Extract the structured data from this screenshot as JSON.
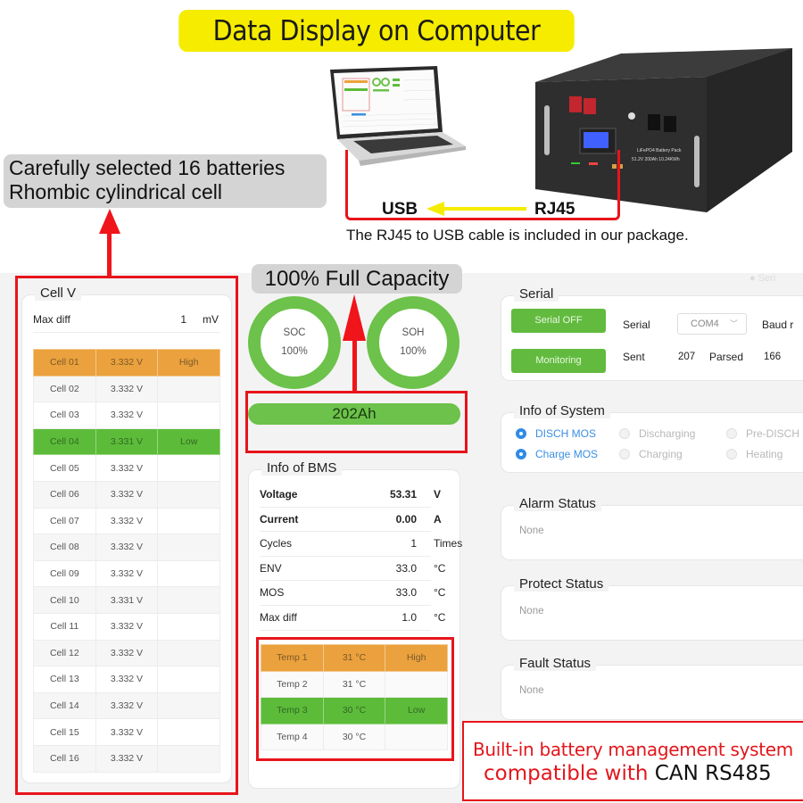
{
  "banner": {
    "title": "Data Display on Computer"
  },
  "connection": {
    "usb_label": "USB",
    "rj45_label": "RJ45",
    "note": "The RJ45 to USB cable is included in our package.",
    "battery_label_line1": "LiFePO4 Battery Pack",
    "battery_label_line2": "51.2V 200Ah 10.24KWh"
  },
  "callouts": {
    "batteries_line1": "Carefully selected 16 batteries",
    "batteries_line2": "Rhombic cylindrical cell",
    "capacity": "100% Full Capacity",
    "bms_line1": "Built-in battery management system",
    "bms_line2_red": "compatible with ",
    "bms_line2_dark": "CAN RS485"
  },
  "colors": {
    "high": "#eba13d",
    "low": "#5dbb3a",
    "accent_green": "#6cc24a",
    "accent_blue": "#2f8ce6",
    "highlight_red": "#e8141b",
    "banner_yellow": "#f5ec00"
  },
  "cell_voltage": {
    "title": "Cell V",
    "max_diff_label": "Max diff",
    "max_diff_value": "1",
    "max_diff_unit": "mV",
    "cells": [
      {
        "name": "Cell 01",
        "voltage": "3.332 V",
        "flag": "High"
      },
      {
        "name": "Cell 02",
        "voltage": "3.332 V",
        "flag": ""
      },
      {
        "name": "Cell 03",
        "voltage": "3.332 V",
        "flag": ""
      },
      {
        "name": "Cell 04",
        "voltage": "3.331 V",
        "flag": "Low"
      },
      {
        "name": "Cell 05",
        "voltage": "3.332 V",
        "flag": ""
      },
      {
        "name": "Cell 06",
        "voltage": "3.332 V",
        "flag": ""
      },
      {
        "name": "Cell 07",
        "voltage": "3.332 V",
        "flag": ""
      },
      {
        "name": "Cell 08",
        "voltage": "3.332 V",
        "flag": ""
      },
      {
        "name": "Cell 09",
        "voltage": "3.332 V",
        "flag": ""
      },
      {
        "name": "Cell 10",
        "voltage": "3.331 V",
        "flag": ""
      },
      {
        "name": "Cell 11",
        "voltage": "3.332 V",
        "flag": ""
      },
      {
        "name": "Cell 12",
        "voltage": "3.332 V",
        "flag": ""
      },
      {
        "name": "Cell 13",
        "voltage": "3.332 V",
        "flag": ""
      },
      {
        "name": "Cell 14",
        "voltage": "3.332 V",
        "flag": ""
      },
      {
        "name": "Cell 15",
        "voltage": "3.332 V",
        "flag": ""
      },
      {
        "name": "Cell 16",
        "voltage": "3.332 V",
        "flag": ""
      }
    ]
  },
  "gauges": {
    "soc_label": "SOC",
    "soc_value": "100%",
    "soh_label": "SOH",
    "soh_value": "100%",
    "capacity": "202Ah"
  },
  "bms": {
    "title": "Info of BMS",
    "rows": [
      {
        "label": "Voltage",
        "value": "53.31",
        "unit": "V",
        "bold": true
      },
      {
        "label": "Current",
        "value": "0.00",
        "unit": "A",
        "bold": true
      },
      {
        "label": "Cycles",
        "value": "1",
        "unit": "Times",
        "bold": false
      },
      {
        "label": "ENV",
        "value": "33.0",
        "unit": "°C",
        "bold": false
      },
      {
        "label": "MOS",
        "value": "33.0",
        "unit": "°C",
        "bold": false
      },
      {
        "label": "Max diff",
        "value": "1.0",
        "unit": "°C",
        "bold": false
      }
    ],
    "temps": [
      {
        "name": "Temp 1",
        "value": "31 °C",
        "flag": "High"
      },
      {
        "name": "Temp 2",
        "value": "31 °C",
        "flag": ""
      },
      {
        "name": "Temp 3",
        "value": "30 °C",
        "flag": "Low"
      },
      {
        "name": "Temp 4",
        "value": "30 °C",
        "flag": ""
      }
    ]
  },
  "serial": {
    "title": "Serial",
    "serial_off_button": "Serial OFF",
    "monitoring_button": "Monitoring",
    "serial_label": "Serial",
    "port_value": "COM4",
    "baud_label": "Baud r",
    "sent_label": "Sent",
    "sent_value": "207",
    "parsed_label": "Parsed",
    "parsed_value": "166"
  },
  "system": {
    "title": "Info of System",
    "indicators": [
      {
        "label": "DISCH MOS",
        "on": true
      },
      {
        "label": "Discharging",
        "on": false
      },
      {
        "label": "Pre-DISCH",
        "on": false
      },
      {
        "label": "Charge MOS",
        "on": true
      },
      {
        "label": "Charging",
        "on": false
      },
      {
        "label": "Heating",
        "on": false
      }
    ]
  },
  "statuses": [
    {
      "title": "Alarm Status",
      "value": "None"
    },
    {
      "title": "Protect Status",
      "value": "None"
    },
    {
      "title": "Fault Status",
      "value": "None"
    }
  ]
}
